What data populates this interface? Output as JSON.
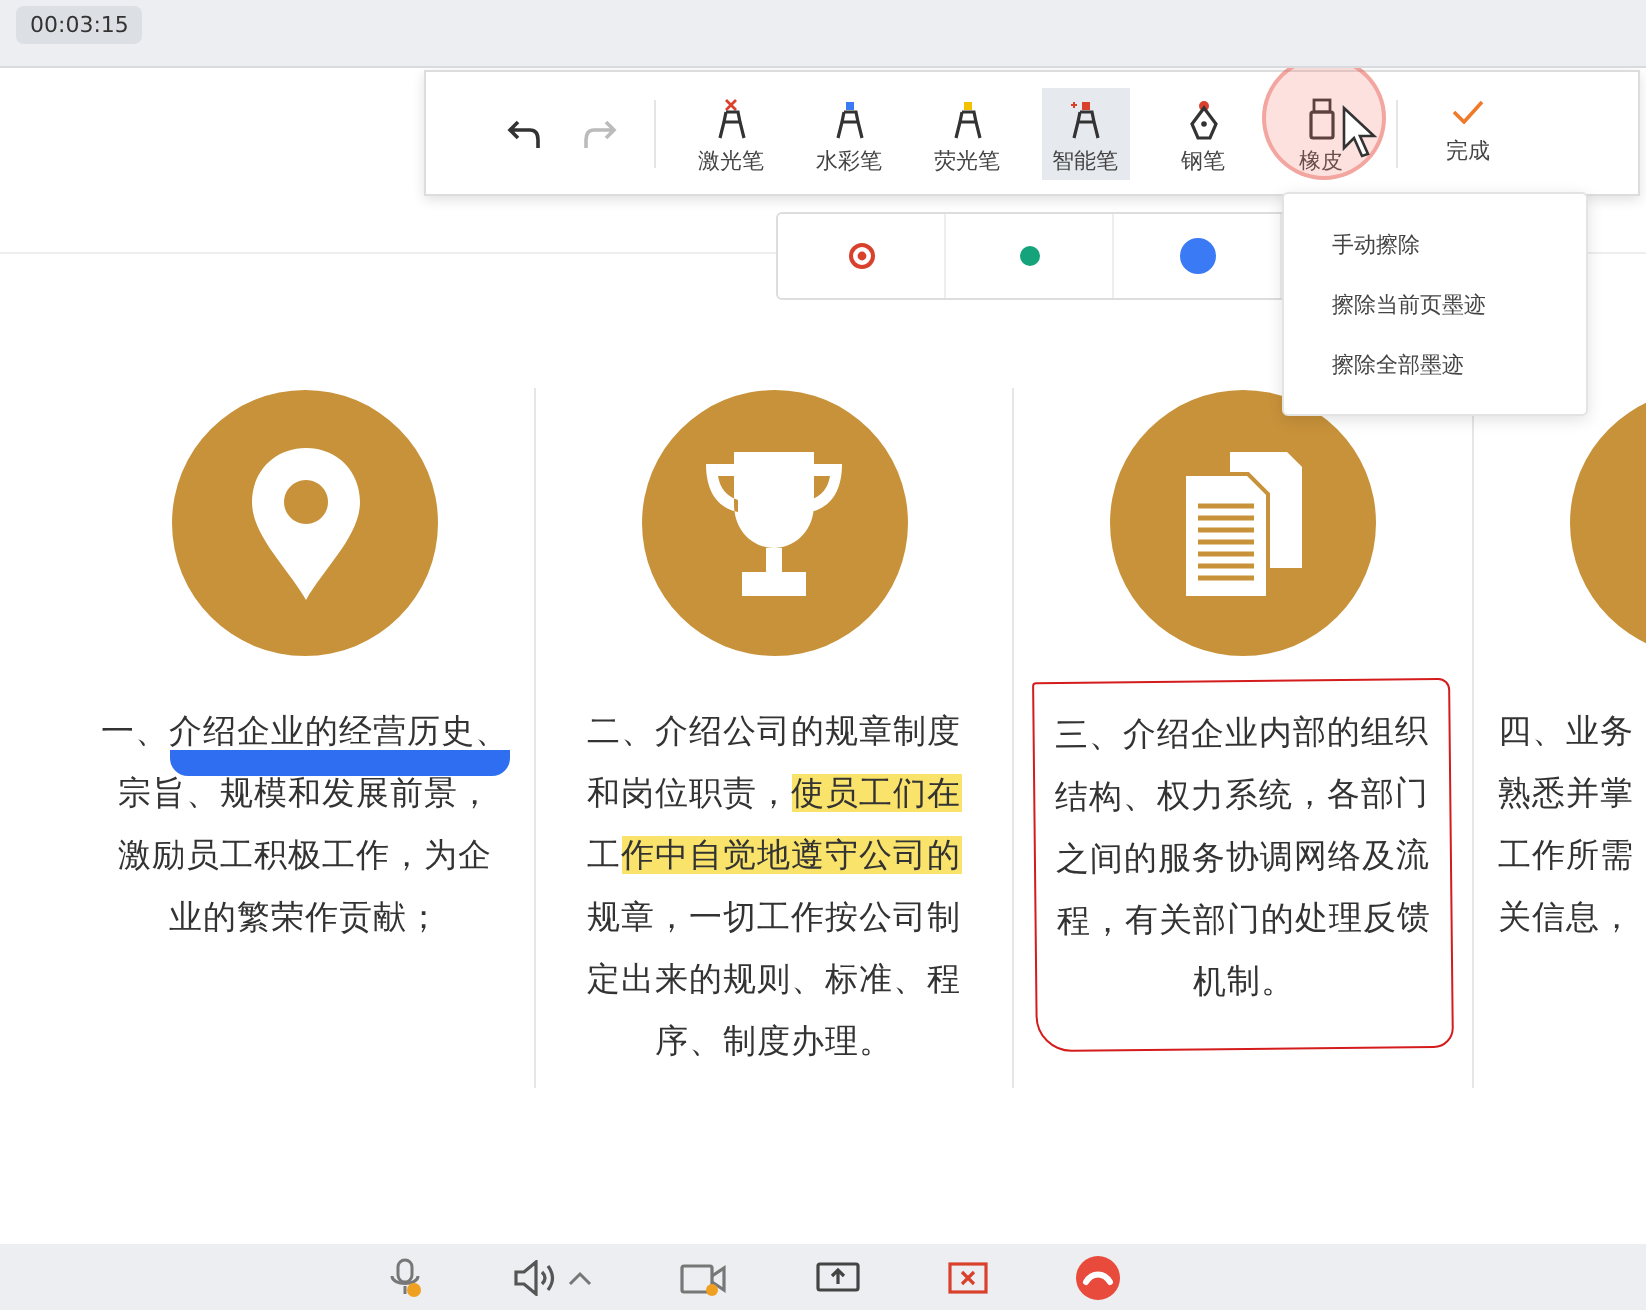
{
  "timer": "00:03:15",
  "toolbar": {
    "tools": [
      {
        "kind": "laser",
        "label": "激光笔",
        "selected": false
      },
      {
        "kind": "watercolor",
        "label": "水彩笔",
        "selected": false
      },
      {
        "kind": "highlighter",
        "label": "荧光笔",
        "selected": false
      },
      {
        "kind": "smart",
        "label": "智能笔",
        "selected": true
      },
      {
        "kind": "fountain",
        "label": "钢笔",
        "selected": false
      },
      {
        "kind": "eraser",
        "label": "橡皮",
        "selected": false
      }
    ],
    "done": "完成"
  },
  "pen_options": [
    {
      "kind": "ring",
      "color": "#d9412d"
    },
    {
      "kind": "small-dot",
      "color": "#14a37a"
    },
    {
      "kind": "large-dot",
      "color": "#3a7bf5"
    }
  ],
  "eraser_menu": [
    "手动擦除",
    "擦除当前页墨迹",
    "擦除全部墨迹"
  ],
  "columns": [
    {
      "kind": "pin",
      "outlined": false,
      "lines": [
        [
          {
            "text": "一、",
            "underlined": false,
            "highlighted": false
          },
          {
            "text": "介绍企业的经营历史、",
            "underlined": true,
            "highlighted": false
          }
        ],
        [
          {
            "text": "宗旨、规模和发展前景，",
            "underlined": false,
            "highlighted": false
          }
        ],
        [
          {
            "text": "激励员工积极工作，为企",
            "underlined": false,
            "highlighted": false
          }
        ],
        [
          {
            "text": "业的繁荣作贡献；",
            "underlined": false,
            "highlighted": false
          }
        ]
      ]
    },
    {
      "kind": "trophy",
      "outlined": false,
      "lines": [
        [
          {
            "text": "二、介绍公司的规章制度",
            "underlined": false,
            "highlighted": false
          }
        ],
        [
          {
            "text": "和岗位职责，",
            "underlined": false,
            "highlighted": false
          },
          {
            "text": "使员工们在",
            "underlined": false,
            "highlighted": true
          }
        ],
        [
          {
            "text": "工",
            "underlined": false,
            "highlighted": false
          },
          {
            "text": "作中自觉地遵守公司的",
            "underlined": false,
            "highlighted": true
          }
        ],
        [
          {
            "text": "规章，一切工作按公司制",
            "underlined": false,
            "highlighted": false
          }
        ],
        [
          {
            "text": "定出来的规则、标准、程",
            "underlined": false,
            "highlighted": false
          }
        ],
        [
          {
            "text": "序、制度办理。",
            "underlined": false,
            "highlighted": false
          }
        ]
      ]
    },
    {
      "kind": "documents",
      "outlined": true,
      "lines": [
        [
          {
            "text": "三、介绍企业内部的组织",
            "underlined": false,
            "highlighted": false
          }
        ],
        [
          {
            "text": "结构、权力系统，各部门",
            "underlined": false,
            "highlighted": false
          }
        ],
        [
          {
            "text": "之间的服务协调网络及流",
            "underlined": false,
            "highlighted": false
          }
        ],
        [
          {
            "text": "程，有关部门的处理反馈",
            "underlined": false,
            "highlighted": false
          }
        ],
        [
          {
            "text": "机制。",
            "underlined": false,
            "highlighted": false
          }
        ]
      ]
    },
    {
      "kind": "partial",
      "outlined": false,
      "lines": [
        [
          {
            "text": "四、业务",
            "underlined": false,
            "highlighted": false
          }
        ],
        [
          {
            "text": "熟悉并掌",
            "underlined": false,
            "highlighted": false
          }
        ],
        [
          {
            "text": "工作所需",
            "underlined": false,
            "highlighted": false
          }
        ],
        [
          {
            "text": "关信息，",
            "underlined": false,
            "highlighted": false
          }
        ]
      ]
    }
  ],
  "call_controls": [
    {
      "kind": "microphone"
    },
    {
      "kind": "speaker"
    },
    {
      "kind": "camera"
    },
    {
      "kind": "share"
    },
    {
      "kind": "stop"
    },
    {
      "kind": "hangup"
    }
  ]
}
